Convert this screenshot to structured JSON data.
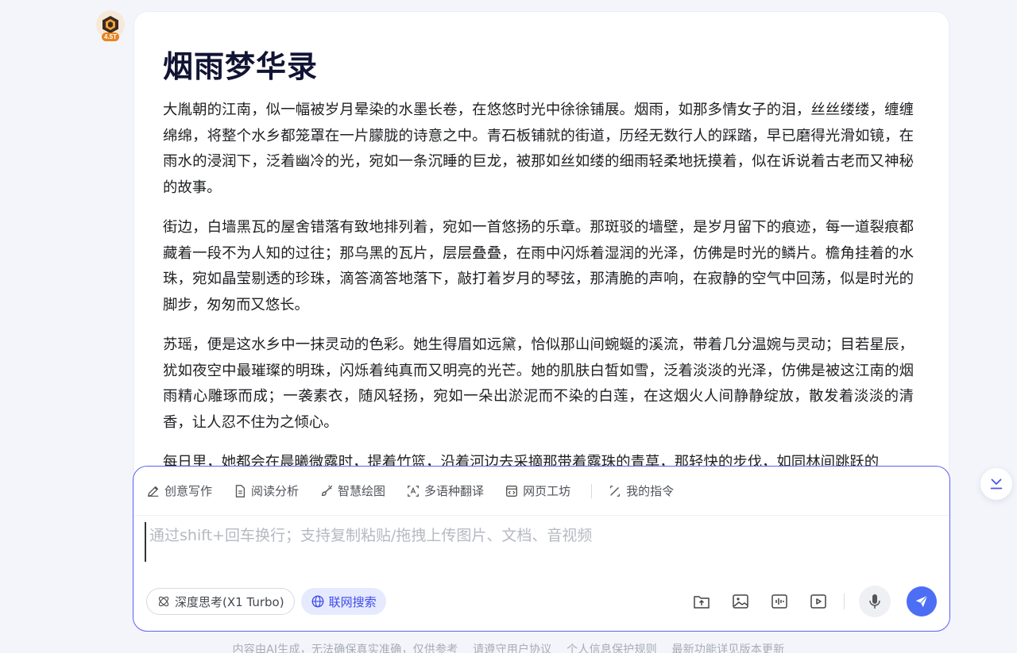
{
  "assistant": {
    "avatar_badge": "4.5T"
  },
  "article": {
    "title": "烟雨梦华录",
    "paragraphs": [
      "大胤朝的江南，似一幅被岁月晕染的水墨长卷，在悠悠时光中徐徐铺展。烟雨，如那多情女子的泪，丝丝缕缕，缠缠绵绵，将整个水乡都笼罩在一片朦胧的诗意之中。青石板铺就的街道，历经无数行人的踩踏，早已磨得光滑如镜，在雨水的浸润下，泛着幽冷的光，宛如一条沉睡的巨龙，被那如丝如缕的细雨轻柔地抚摸着，似在诉说着古老而又神秘的故事。",
      "街边，白墙黑瓦的屋舍错落有致地排列着，宛如一首悠扬的乐章。那斑驳的墙壁，是岁月留下的痕迹，每一道裂痕都藏着一段不为人知的过往；那乌黑的瓦片，层层叠叠，在雨中闪烁着湿润的光泽，仿佛是时光的鳞片。檐角挂着的水珠，宛如晶莹剔透的珍珠，滴答滴答地落下，敲打着岁月的琴弦，那清脆的声响，在寂静的空气中回荡，似是时光的脚步，匆匆而又悠长。",
      "苏瑶，便是这水乡中一抹灵动的色彩。她生得眉如远黛，恰似那山间蜿蜒的溪流，带着几分温婉与灵动；目若星辰，犹如夜空中最璀璨的明珠，闪烁着纯真而又明亮的光芒。她的肌肤白皙如雪，泛着淡淡的光泽，仿佛是被这江南的烟雨精心雕琢而成；一袭素衣，随风轻扬，宛如一朵出淤泥而不染的白莲，在这烟火人间静静绽放，散发着淡淡的清香，让人忍不住为之倾心。",
      "每日里，她都会在晨曦微露时，提着竹篮，沿着河边去采摘那带着露珠的青草，那轻快的步伐，如同林间跳跃的"
    ]
  },
  "composer": {
    "tools": [
      {
        "label": "创意写作",
        "icon": "pen-icon"
      },
      {
        "label": "阅读分析",
        "icon": "document-icon"
      },
      {
        "label": "智慧绘图",
        "icon": "brush-icon"
      },
      {
        "label": "多语种翻译",
        "icon": "translate-icon"
      },
      {
        "label": "网页工坊",
        "icon": "webpage-icon"
      },
      {
        "label": "我的指令",
        "icon": "command-icon"
      }
    ],
    "placeholder": "通过shift+回车换行；支持复制粘贴/拖拽上传图片、文档、音视频",
    "deep_think_label": "深度思考(X1 Turbo)",
    "web_search_label": "联网搜索",
    "action_icons": [
      "upload-folder-icon",
      "image-icon",
      "audio-icon",
      "video-icon",
      "microphone-icon",
      "send-icon"
    ]
  },
  "footer": {
    "items": [
      "内容由AI生成，无法确保真实准确，仅供参考",
      "请遵守用户协议",
      "个人信息保护规则",
      "最新功能详见版本更新"
    ]
  },
  "colors": {
    "accent": "#4c6ef5",
    "composer_border": "#5a62f2",
    "web_search_bg": "#e6eaff"
  }
}
